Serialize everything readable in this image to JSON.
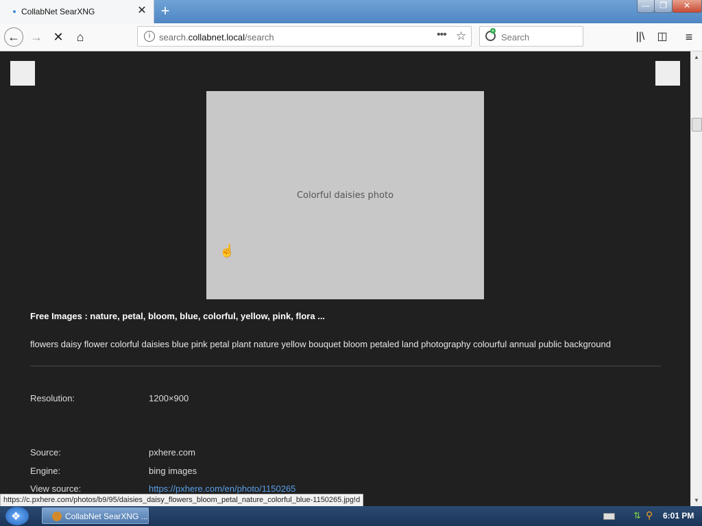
{
  "browser": {
    "tab_title": "CollabNet SearXNG",
    "tab_close": "✕",
    "new_tab": "+",
    "url_prefix": "search.",
    "url_domain": "collabnet.local",
    "url_path": "/search",
    "search_placeholder": "Search",
    "page_actions": "•••"
  },
  "result": {
    "title": "Free Images : nature, petal, bloom, blue, colorful, yellow, pink, flora ...",
    "description": "flowers daisy flower colorful daisies blue pink petal plant nature yellow bouquet bloom petaled land photography colourful annual public background",
    "image_label": "Colorful daisies photo",
    "fields": {
      "resolution_label": "Resolution:",
      "resolution_value": "1200×900",
      "source_label": "Source:",
      "source_value": "pxhere.com",
      "engine_label": "Engine:",
      "engine_value": "bing images",
      "view_source_label": "View source:",
      "view_source_value": "https://pxhere.com/en/photo/1150265"
    }
  },
  "status_url": "https://c.pxhere.com/photos/b9/95/daisies_daisy_flowers_bloom_petal_nature_colorful_blue-1150265.jpg!d",
  "taskbar": {
    "item_label": "CollabNet SearXNG ...",
    "clock": "6:01 PM"
  },
  "icons": {
    "back": "back-arrow-icon",
    "forward": "forward-arrow-icon",
    "stop": "stop-icon",
    "home": "home-icon",
    "library": "library-icon",
    "sidebar": "sidebar-icon",
    "menu": "hamburger-menu-icon"
  }
}
